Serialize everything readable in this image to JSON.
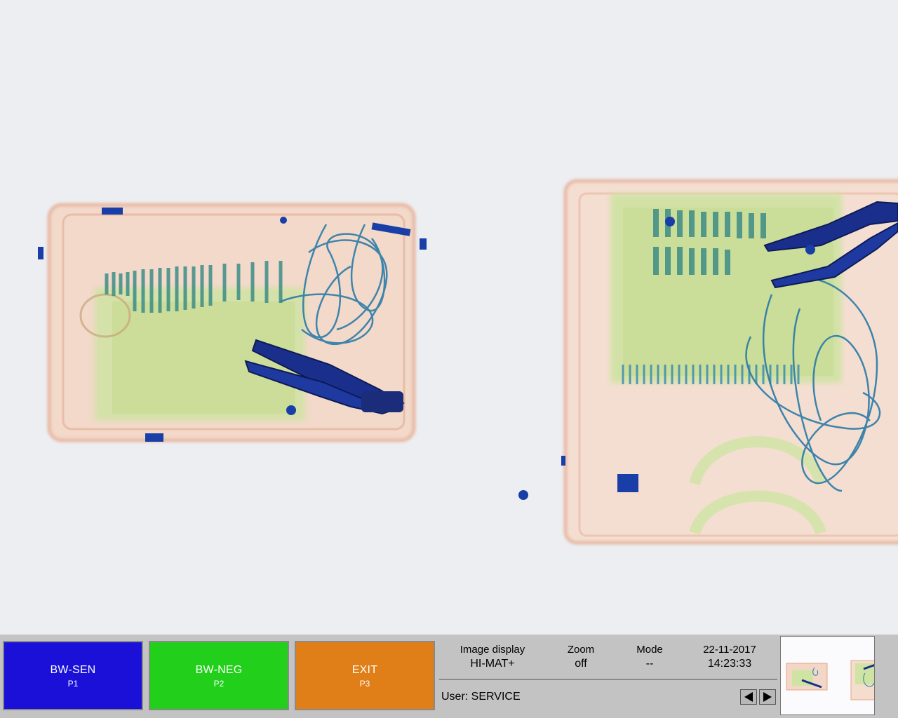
{
  "softkeys": [
    {
      "label": "BW-SEN",
      "sub": "P1"
    },
    {
      "label": "BW-NEG",
      "sub": "P2"
    },
    {
      "label": "EXIT",
      "sub": "P3"
    }
  ],
  "status": {
    "image_display_label": "Image display",
    "image_display_value": "HI-MAT+",
    "zoom_label": "Zoom",
    "zoom_value": "off",
    "mode_label": "Mode",
    "mode_value": "--",
    "date": "22-11-2017",
    "time": "14:23:33"
  },
  "user": "User: SERVICE",
  "colors": {
    "bw_sen": "#1a10d8",
    "bw_neg": "#22d01c",
    "exit": "#e07e18",
    "organic": "#e8a080",
    "inorganic": "#9cd070",
    "metal": "#1a3a90"
  },
  "icons": {
    "prev": "triangle-left-icon",
    "next": "triangle-right-icon"
  }
}
